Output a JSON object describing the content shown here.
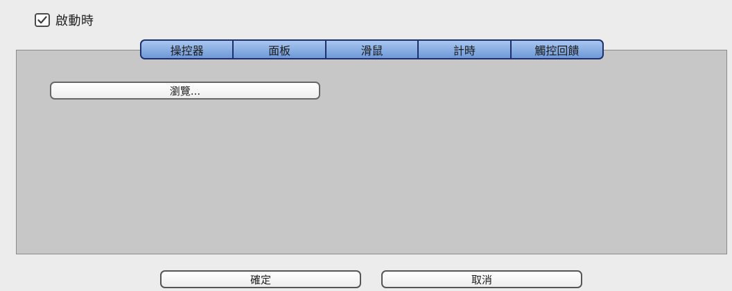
{
  "top_checkbox": {
    "checked": true,
    "label": "啟動時"
  },
  "tabs": [
    {
      "label": "操控器"
    },
    {
      "label": "面板"
    },
    {
      "label": "滑鼠"
    },
    {
      "label": "計時"
    },
    {
      "label": "觸控回饋"
    }
  ],
  "panel": {
    "browse_button_label": "瀏覽..."
  },
  "dialog_buttons": {
    "ok_label": "確定",
    "cancel_label": "取消"
  },
  "colors": {
    "background": "#ececec",
    "panel": "#c7c7c7",
    "tab_fill": "#8fb2e6",
    "tab_border": "#1f2f6e"
  },
  "icons": {
    "top_checkbox": "checkmark-icon"
  }
}
